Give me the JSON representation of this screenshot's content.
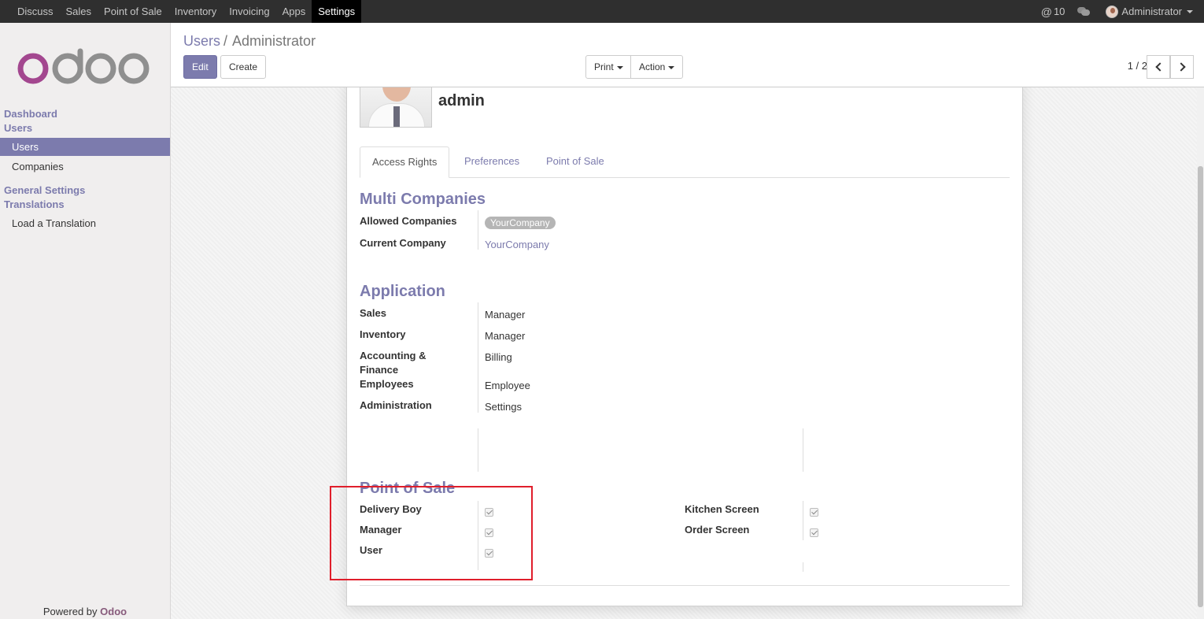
{
  "topbar": {
    "menu": [
      "Discuss",
      "Sales",
      "Point of Sale",
      "Inventory",
      "Invoicing",
      "Apps",
      "Settings"
    ],
    "active": "Settings",
    "mentions": "10",
    "user": "Administrator"
  },
  "sidebar": {
    "logo_text": "odoo",
    "sections": {
      "dashboard": "Dashboard",
      "users": "Users",
      "general_settings": "General Settings",
      "translations": "Translations"
    },
    "links": {
      "users": "Users",
      "companies": "Companies",
      "load_translation": "Load a Translation"
    },
    "powered_prefix": "Powered by",
    "powered_brand": "Odoo"
  },
  "control": {
    "breadcrumb_link": "Users",
    "breadcrumb_sep": "/",
    "breadcrumb_current": "Administrator",
    "edit": "Edit",
    "create": "Create",
    "print": "Print",
    "action": "Action",
    "pager": "1 / 2"
  },
  "form": {
    "name": "admin",
    "tabs": [
      "Access Rights",
      "Preferences",
      "Point of Sale"
    ],
    "multi_companies": {
      "title": "Multi Companies",
      "allowed_label": "Allowed Companies",
      "allowed_value": "YourCompany",
      "current_label": "Current Company",
      "current_value": "YourCompany"
    },
    "application": {
      "title": "Application",
      "rows": [
        {
          "label": "Sales",
          "value": "Manager"
        },
        {
          "label": "Inventory",
          "value": "Manager"
        },
        {
          "label": "Accounting & Finance",
          "value": "Billing"
        },
        {
          "label": "Employees",
          "value": "Employee"
        },
        {
          "label": "Administration",
          "value": "Settings"
        }
      ]
    },
    "pos": {
      "title": "Point of Sale",
      "left": [
        "Delivery Boy",
        "Manager",
        "User"
      ],
      "right": [
        "Kitchen Screen",
        "Order Screen"
      ]
    }
  },
  "colors": {
    "accent": "#7c7bad",
    "brand": "#875a7b",
    "highlight": "#e01e2b"
  }
}
